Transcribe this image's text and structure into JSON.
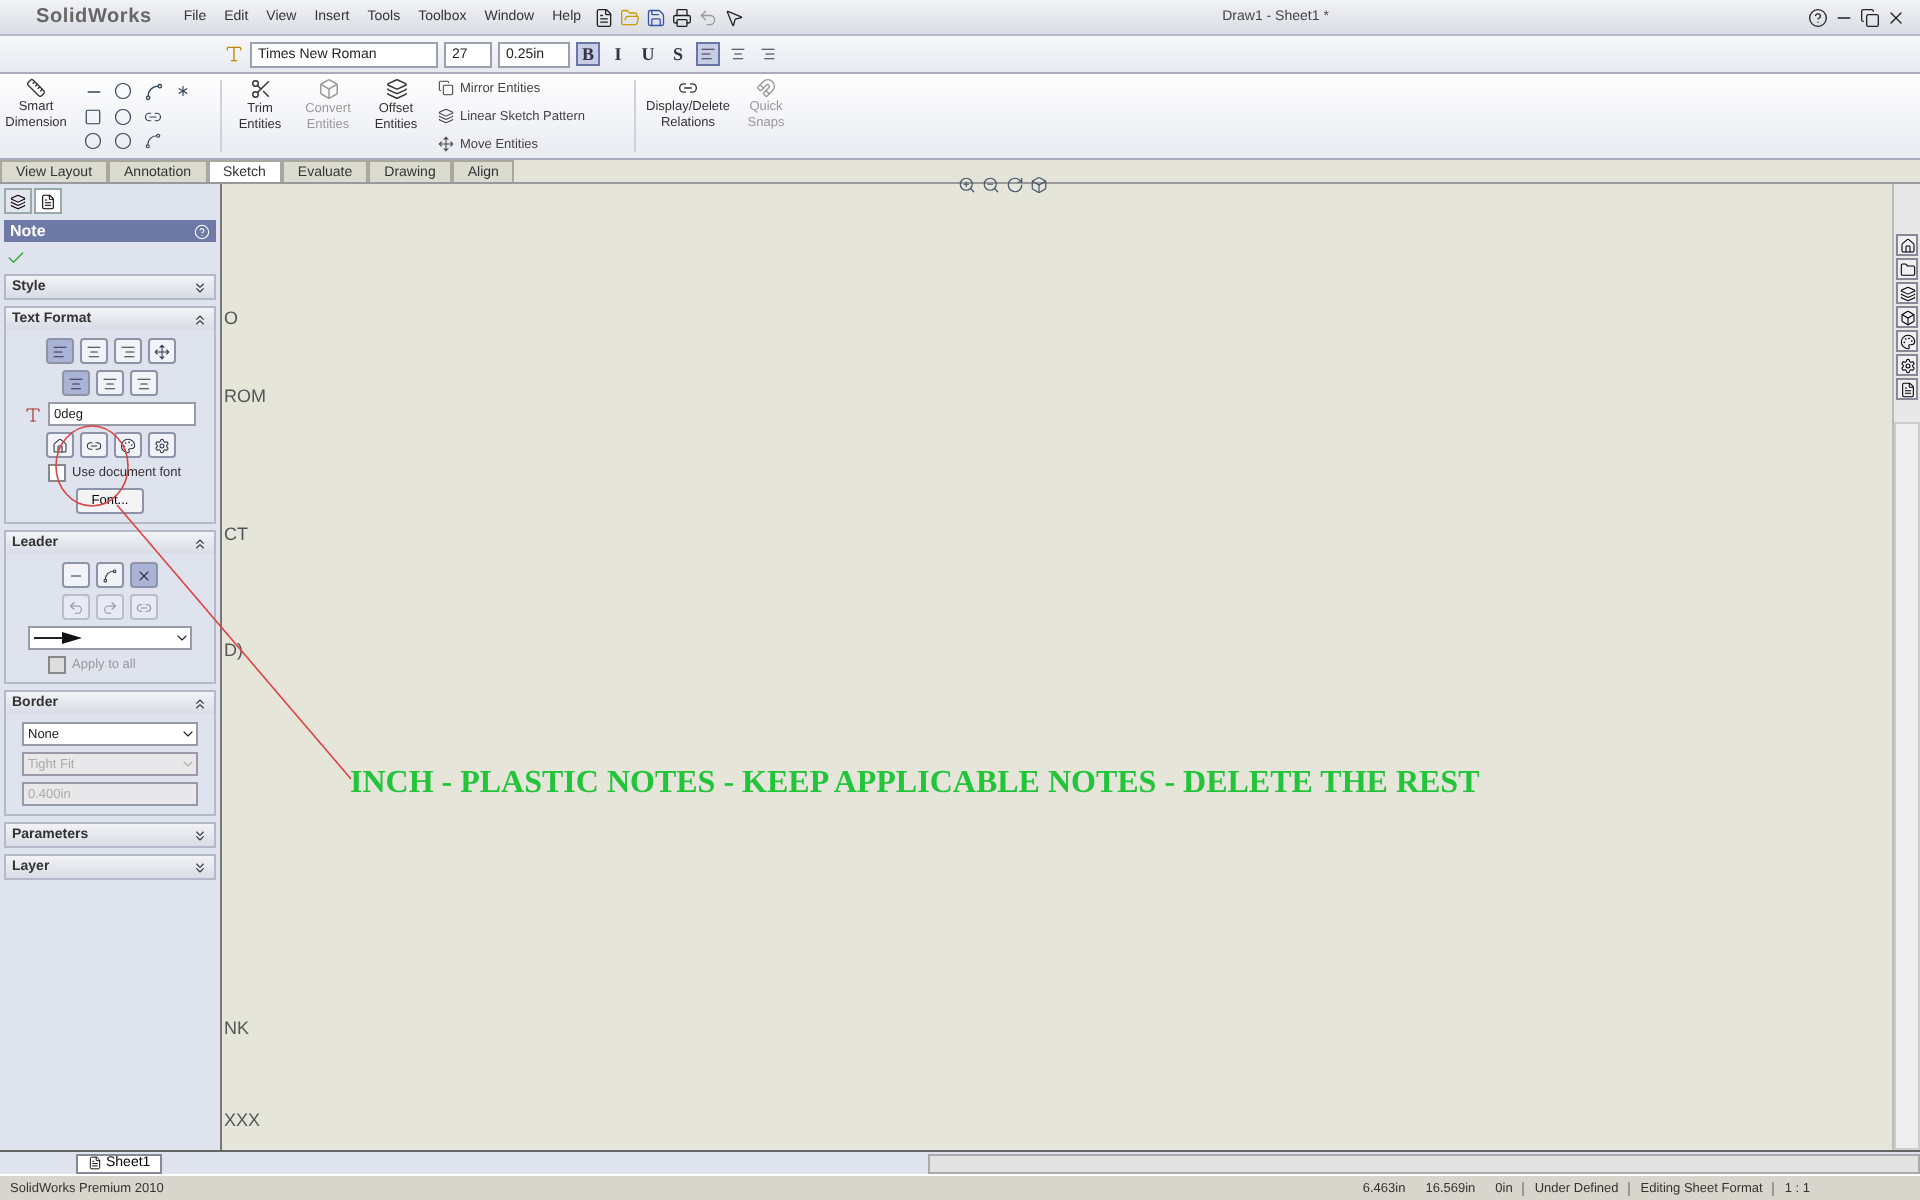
{
  "app": {
    "logo": "SolidWorks",
    "menus": [
      "File",
      "Edit",
      "View",
      "Insert",
      "Tools",
      "Toolbox",
      "Window",
      "Help"
    ],
    "title": "Draw1 - Sheet1 *"
  },
  "format_bar": {
    "font": "Times New Roman",
    "size": "27",
    "height": "0.25in",
    "styles": [
      {
        "label": "B",
        "selected": true
      },
      {
        "label": "I",
        "selected": false
      },
      {
        "label": "U",
        "selected": false
      },
      {
        "label": "S",
        "selected": false
      }
    ],
    "aligns": [
      {
        "selected": true
      },
      {
        "selected": false
      },
      {
        "selected": false
      }
    ]
  },
  "ribbon": {
    "tools": [
      {
        "label": "Smart Dimension",
        "disabled": false
      },
      {
        "label": "Trim Entities",
        "disabled": false
      },
      {
        "label": "Convert Entities",
        "disabled": true
      },
      {
        "label": "Offset Entities",
        "disabled": false
      }
    ],
    "list": [
      "Mirror Entities",
      "Linear Sketch Pattern",
      "Move Entities"
    ],
    "relations": [
      {
        "label": "Display/Delete Relations",
        "disabled": false
      },
      {
        "label": "Quick Snaps",
        "disabled": true
      }
    ]
  },
  "tabs": [
    {
      "label": "View Layout",
      "selected": false
    },
    {
      "label": "Annotation",
      "selected": false
    },
    {
      "label": "Sketch",
      "selected": true
    },
    {
      "label": "Evaluate",
      "selected": false
    },
    {
      "label": "Drawing",
      "selected": false
    },
    {
      "label": "Align",
      "selected": false
    }
  ],
  "panel": {
    "title": "Note",
    "style": {
      "title": "Style",
      "expanded": false
    },
    "text_format": {
      "title": "Text Format",
      "expanded": true,
      "angle": "0deg",
      "use_document_font": {
        "label": "Use document font",
        "checked": false
      },
      "font_button": "Font..."
    },
    "leader": {
      "title": "Leader",
      "expanded": true,
      "apply_to_all": {
        "label": "Apply to all",
        "checked": false
      }
    },
    "border": {
      "title": "Border",
      "expanded": true,
      "style": "None",
      "size": "Tight Fit",
      "padding": "0.400in"
    },
    "collapsed": [
      {
        "title": "Parameters",
        "expanded": false
      },
      {
        "title": "Layer",
        "expanded": false
      }
    ]
  },
  "canvas": {
    "fragments": [
      "O",
      "ROM",
      "CT",
      "D)",
      "NK",
      "XXX"
    ],
    "note": "INCH - PLASTIC NOTES - KEEP APPLICABLE NOTES - DELETE THE REST"
  },
  "sheet_tabs": [
    {
      "label": "Sheet1",
      "selected": true
    }
  ],
  "status_bar": {
    "product": "SolidWorks Premium 2010",
    "x": "6.463in",
    "y": "16.569in",
    "z": "0in",
    "state": "Under Defined",
    "mode": "Editing Sheet Format",
    "scale": "1 : 1"
  }
}
